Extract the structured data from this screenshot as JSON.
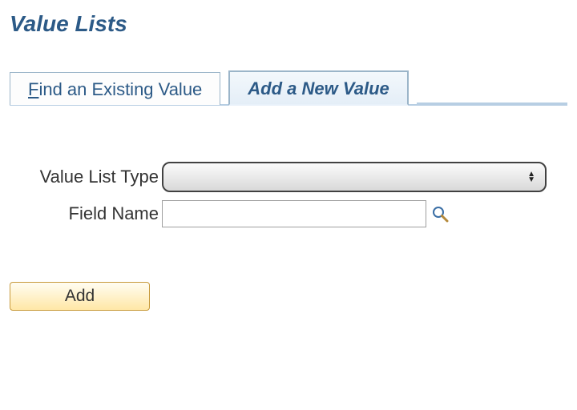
{
  "page": {
    "title": "Value Lists"
  },
  "tabs": {
    "find": {
      "prefix": "F",
      "rest": "ind an Existing Value"
    },
    "add": {
      "label": "Add a New Value"
    },
    "active": "add"
  },
  "form": {
    "valueListType": {
      "label": "Value List Type",
      "value": ""
    },
    "fieldName": {
      "label": "Field Name",
      "value": ""
    }
  },
  "buttons": {
    "add": "Add"
  }
}
